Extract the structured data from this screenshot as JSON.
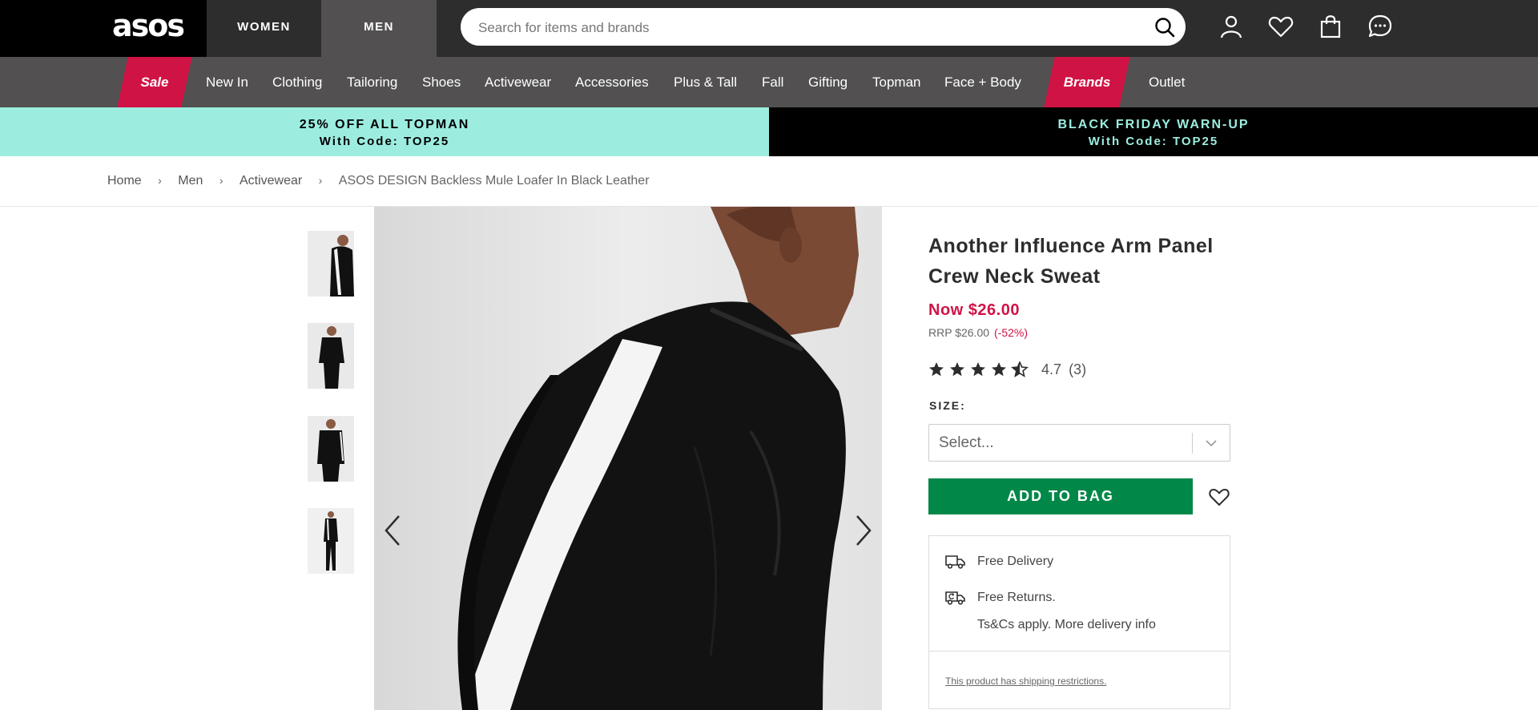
{
  "header": {
    "logo": "asos",
    "tabs": [
      "WOMEN",
      "MEN"
    ],
    "active_tab": "MEN",
    "search_placeholder": "Search for items and brands"
  },
  "nav": {
    "sale": "Sale",
    "items": [
      "New In",
      "Clothing",
      "Tailoring",
      "Shoes",
      "Activewear",
      "Accessories",
      "Plus & Tall",
      "Fall",
      "Gifting",
      "Topman",
      "Face + Body"
    ],
    "brands": "Brands",
    "outlet": "Outlet"
  },
  "promo": {
    "left_line1": "25% OFF ALL TOPMAN",
    "left_line2": "With Code: TOP25",
    "right_line1": "BLACK FRIDAY WARN-UP",
    "right_line2": "With Code: TOP25"
  },
  "breadcrumb": [
    "Home",
    "Men",
    "Activewear",
    "ASOS DESIGN Backless Mule Loafer In Black Leather"
  ],
  "product": {
    "title": "Another Influence Arm Panel Crew Neck Sweat",
    "price_now": "Now $26.00",
    "price_rrp": "RRP $26.00",
    "discount": "(-52%)",
    "rating": "4.7",
    "review_count": "(3)",
    "rating_value": 4.7,
    "size_label": "SIZE:",
    "size_placeholder": "Select...",
    "add_to_bag": "ADD TO BAG"
  },
  "delivery": {
    "free_delivery": "Free Delivery",
    "free_returns": "Free Returns.",
    "terms": "Ts&Cs apply. More delivery info",
    "restrictions": "This product has shipping restrictions."
  },
  "colors": {
    "accent_red": "#d01345",
    "promo_mint": "#9cede0",
    "add_green": "#018849",
    "nav_grey": "#525050",
    "top_dark": "#2d2d2d"
  }
}
